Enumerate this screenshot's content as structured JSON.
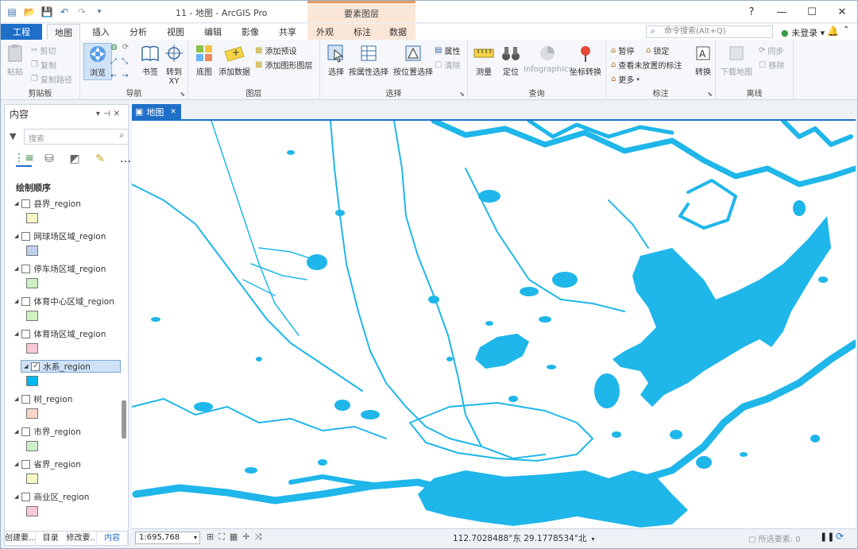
{
  "window": {
    "title": "11 - 地图 - ArcGIS Pro",
    "context_group": "要素图层"
  },
  "quick_access": {
    "icons": [
      "new-project-icon",
      "open-icon",
      "save-icon",
      "undo-icon",
      "redo-icon",
      "customize-icon"
    ]
  },
  "window_controls": {
    "help": "?",
    "minimize": "—",
    "maximize": "☐",
    "close": "✕"
  },
  "tabs": [
    {
      "label": "工程"
    },
    {
      "label": "地图"
    },
    {
      "label": "插入"
    },
    {
      "label": "分析"
    },
    {
      "label": "视图"
    },
    {
      "label": "编辑"
    },
    {
      "label": "影像"
    },
    {
      "label": "共享"
    },
    {
      "label": "外观"
    },
    {
      "label": "标注"
    },
    {
      "label": "数据"
    }
  ],
  "command_search": {
    "placeholder": "命令搜索(Alt+Q)"
  },
  "account": {
    "label": "未登录"
  },
  "ribbon": {
    "clipboard": {
      "group": "剪贴板",
      "paste": "粘贴",
      "cut": "剪切",
      "copy": "复制",
      "copy_path": "复制路径"
    },
    "navigate": {
      "group": "导航",
      "explore": "浏览",
      "bookmarks": "书签",
      "goto_xy_1": "转到",
      "goto_xy_2": "XY"
    },
    "layer": {
      "group": "图层",
      "basemap": "底图",
      "add_data": "添加数据",
      "add_preset": "添加预设",
      "add_graphics": "添加图形图层"
    },
    "selection": {
      "group": "选择",
      "select": "选择",
      "by_attr": "按属性选择",
      "by_loc": "按位置选择",
      "attributes": "属性",
      "clear": "清除"
    },
    "inquiry": {
      "group": "查询",
      "measure": "测量",
      "locate": "定位",
      "infographics": "Infographics",
      "coord_conv": "坐标转换"
    },
    "labeling": {
      "group": "标注",
      "pause": "暂停",
      "lock": "锁定",
      "unplaced": "查看未放置的标注",
      "more": "更多",
      "convert": "转换"
    },
    "offline": {
      "group": "离线",
      "download_map": "下载地图",
      "sync": "同步",
      "remove": "移除"
    }
  },
  "contents_pane": {
    "title": "内容",
    "search_placeholder": "搜索",
    "drawing_order_label": "绘制顺序",
    "layers": [
      {
        "name": "县界_region",
        "color": "#f7f7c4",
        "checked": false
      },
      {
        "name": "网球场区域_region",
        "color": "#bcd0ee",
        "checked": false
      },
      {
        "name": "停车场区域_region",
        "color": "#ccf0c4",
        "checked": false
      },
      {
        "name": "体育中心区域_region",
        "color": "#d0f2c0",
        "checked": false
      },
      {
        "name": "体育场区域_region",
        "color": "#f7c9d4",
        "checked": false
      },
      {
        "name": "水系_region",
        "color": "#00b8f0",
        "checked": true
      },
      {
        "name": "树_region",
        "color": "#f6d7c8",
        "checked": false
      },
      {
        "name": "市界_region",
        "color": "#c9f0c4",
        "checked": false
      },
      {
        "name": "省界_region",
        "color": "#f7f7c4",
        "checked": false
      },
      {
        "name": "商业区_region",
        "color": "#f7c9d4",
        "checked": false
      }
    ],
    "bottom_tabs": [
      {
        "label": "创建要..."
      },
      {
        "label": "目录"
      },
      {
        "label": "修改要..."
      },
      {
        "label": "内容"
      }
    ]
  },
  "map_view": {
    "tab_label": "地图",
    "water_color": "#1fb6ea"
  },
  "status_bar": {
    "scale": "1:695,768",
    "coordinates": "112.7028488°东 29.1778534°北",
    "selected_features": "所选要素: 0"
  }
}
